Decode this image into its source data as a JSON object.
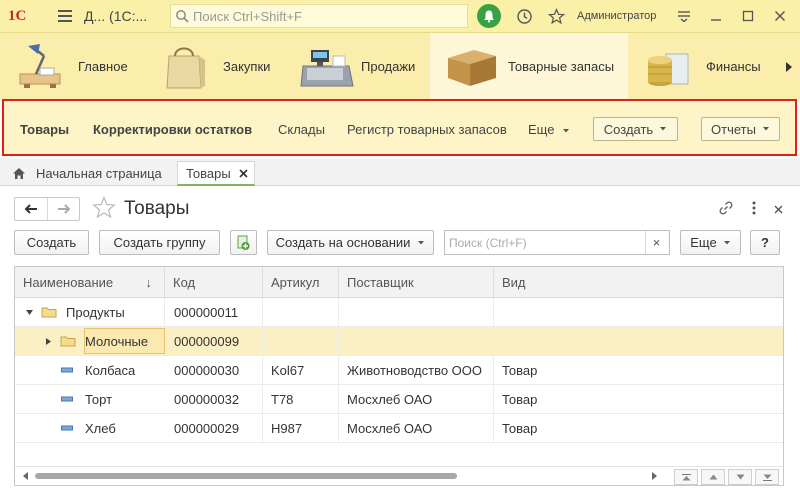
{
  "titlebar": {
    "logo": "1С",
    "doc_title": "Д... (1С:...",
    "search_placeholder": "Поиск Ctrl+Shift+F",
    "username": "Администратор"
  },
  "sections": [
    {
      "label": "Главное",
      "icon": "desk-lamp-icon"
    },
    {
      "label": "Закупки",
      "icon": "shopping-bag-icon"
    },
    {
      "label": "Продажи",
      "icon": "cash-register-icon"
    },
    {
      "label": "Товарные запасы",
      "icon": "box-icon"
    },
    {
      "label": "Финансы",
      "icon": "coins-icon"
    }
  ],
  "function_panel": {
    "items": [
      "Товары",
      "Корректировки остатков",
      "Склады",
      "Регистр товарных запасов"
    ],
    "more_label": "Еще",
    "create_label": "Создать",
    "reports_label": "Отчеты"
  },
  "open_tabs": [
    {
      "label": "Начальная страница"
    },
    {
      "label": "Товары"
    }
  ],
  "form": {
    "title": "Товары",
    "buttons": {
      "create": "Создать",
      "create_group": "Создать группу",
      "create_based_on": "Создать на основании",
      "more": "Еще",
      "help": "?"
    },
    "search_placeholder": "Поиск (Ctrl+F)",
    "search_value": "",
    "clear_label": "×"
  },
  "table": {
    "columns": [
      "Наименование",
      "Код",
      "Артикул",
      "Поставщик",
      "Вид"
    ],
    "sort_indicator": "↓",
    "rows": [
      {
        "name": "Продукты",
        "code": "000000011",
        "article": "",
        "supplier": "",
        "kind": "",
        "type": "group",
        "expanded": true
      },
      {
        "name": "Молочные",
        "code": "000000099",
        "article": "",
        "supplier": "",
        "kind": "",
        "type": "group",
        "expanded": false
      },
      {
        "name": "Колбаса",
        "code": "000000030",
        "article": "Kol67",
        "supplier": "Животноводство ООО",
        "kind": "Товар",
        "type": "item"
      },
      {
        "name": "Торт",
        "code": "000000032",
        "article": "Т78",
        "supplier": "Мосхлеб ОАО",
        "kind": "Товар",
        "type": "item"
      },
      {
        "name": "Хлеб",
        "code": "000000029",
        "article": "Н987",
        "supplier": "Мосхлеб ОАО",
        "kind": "Товар",
        "type": "item"
      }
    ],
    "selected_row": 1,
    "horizontal_scroll_fraction": 0.67
  },
  "colors": {
    "titlebar": "#fbf0a8",
    "sections": "#fbedab",
    "highlight_border": "#e0201b",
    "selected_row": "#fbf0c4",
    "notification": "#3aa142"
  }
}
